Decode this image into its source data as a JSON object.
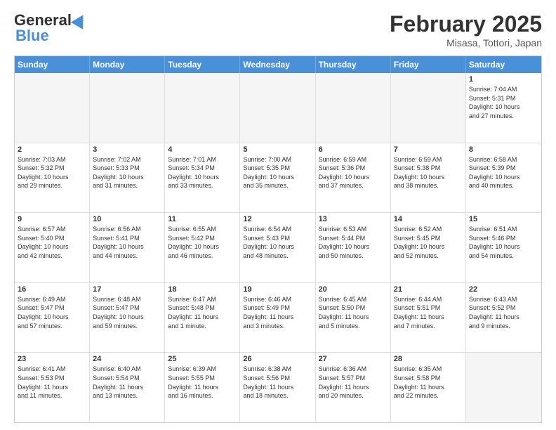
{
  "header": {
    "logo_general": "General",
    "logo_blue": "Blue",
    "month_title": "February 2025",
    "location": "Misasa, Tottori, Japan"
  },
  "weekdays": [
    "Sunday",
    "Monday",
    "Tuesday",
    "Wednesday",
    "Thursday",
    "Friday",
    "Saturday"
  ],
  "weeks": [
    [
      {
        "day": "",
        "text": ""
      },
      {
        "day": "",
        "text": ""
      },
      {
        "day": "",
        "text": ""
      },
      {
        "day": "",
        "text": ""
      },
      {
        "day": "",
        "text": ""
      },
      {
        "day": "",
        "text": ""
      },
      {
        "day": "1",
        "text": "Sunrise: 7:04 AM\nSunset: 5:31 PM\nDaylight: 10 hours\nand 27 minutes."
      }
    ],
    [
      {
        "day": "2",
        "text": "Sunrise: 7:03 AM\nSunset: 5:32 PM\nDaylight: 10 hours\nand 29 minutes."
      },
      {
        "day": "3",
        "text": "Sunrise: 7:02 AM\nSunset: 5:33 PM\nDaylight: 10 hours\nand 31 minutes."
      },
      {
        "day": "4",
        "text": "Sunrise: 7:01 AM\nSunset: 5:34 PM\nDaylight: 10 hours\nand 33 minutes."
      },
      {
        "day": "5",
        "text": "Sunrise: 7:00 AM\nSunset: 5:35 PM\nDaylight: 10 hours\nand 35 minutes."
      },
      {
        "day": "6",
        "text": "Sunrise: 6:59 AM\nSunset: 5:36 PM\nDaylight: 10 hours\nand 37 minutes."
      },
      {
        "day": "7",
        "text": "Sunrise: 6:59 AM\nSunset: 5:38 PM\nDaylight: 10 hours\nand 38 minutes."
      },
      {
        "day": "8",
        "text": "Sunrise: 6:58 AM\nSunset: 5:39 PM\nDaylight: 10 hours\nand 40 minutes."
      }
    ],
    [
      {
        "day": "9",
        "text": "Sunrise: 6:57 AM\nSunset: 5:40 PM\nDaylight: 10 hours\nand 42 minutes."
      },
      {
        "day": "10",
        "text": "Sunrise: 6:56 AM\nSunset: 5:41 PM\nDaylight: 10 hours\nand 44 minutes."
      },
      {
        "day": "11",
        "text": "Sunrise: 6:55 AM\nSunset: 5:42 PM\nDaylight: 10 hours\nand 46 minutes."
      },
      {
        "day": "12",
        "text": "Sunrise: 6:54 AM\nSunset: 5:43 PM\nDaylight: 10 hours\nand 48 minutes."
      },
      {
        "day": "13",
        "text": "Sunrise: 6:53 AM\nSunset: 5:44 PM\nDaylight: 10 hours\nand 50 minutes."
      },
      {
        "day": "14",
        "text": "Sunrise: 6:52 AM\nSunset: 5:45 PM\nDaylight: 10 hours\nand 52 minutes."
      },
      {
        "day": "15",
        "text": "Sunrise: 6:51 AM\nSunset: 5:46 PM\nDaylight: 10 hours\nand 54 minutes."
      }
    ],
    [
      {
        "day": "16",
        "text": "Sunrise: 6:49 AM\nSunset: 5:47 PM\nDaylight: 10 hours\nand 57 minutes."
      },
      {
        "day": "17",
        "text": "Sunrise: 6:48 AM\nSunset: 5:47 PM\nDaylight: 10 hours\nand 59 minutes."
      },
      {
        "day": "18",
        "text": "Sunrise: 6:47 AM\nSunset: 5:48 PM\nDaylight: 11 hours\nand 1 minute."
      },
      {
        "day": "19",
        "text": "Sunrise: 6:46 AM\nSunset: 5:49 PM\nDaylight: 11 hours\nand 3 minutes."
      },
      {
        "day": "20",
        "text": "Sunrise: 6:45 AM\nSunset: 5:50 PM\nDaylight: 11 hours\nand 5 minutes."
      },
      {
        "day": "21",
        "text": "Sunrise: 6:44 AM\nSunset: 5:51 PM\nDaylight: 11 hours\nand 7 minutes."
      },
      {
        "day": "22",
        "text": "Sunrise: 6:43 AM\nSunset: 5:52 PM\nDaylight: 11 hours\nand 9 minutes."
      }
    ],
    [
      {
        "day": "23",
        "text": "Sunrise: 6:41 AM\nSunset: 5:53 PM\nDaylight: 11 hours\nand 11 minutes."
      },
      {
        "day": "24",
        "text": "Sunrise: 6:40 AM\nSunset: 5:54 PM\nDaylight: 11 hours\nand 13 minutes."
      },
      {
        "day": "25",
        "text": "Sunrise: 6:39 AM\nSunset: 5:55 PM\nDaylight: 11 hours\nand 16 minutes."
      },
      {
        "day": "26",
        "text": "Sunrise: 6:38 AM\nSunset: 5:56 PM\nDaylight: 11 hours\nand 18 minutes."
      },
      {
        "day": "27",
        "text": "Sunrise: 6:36 AM\nSunset: 5:57 PM\nDaylight: 11 hours\nand 20 minutes."
      },
      {
        "day": "28",
        "text": "Sunrise: 6:35 AM\nSunset: 5:58 PM\nDaylight: 11 hours\nand 22 minutes."
      },
      {
        "day": "",
        "text": ""
      }
    ]
  ]
}
